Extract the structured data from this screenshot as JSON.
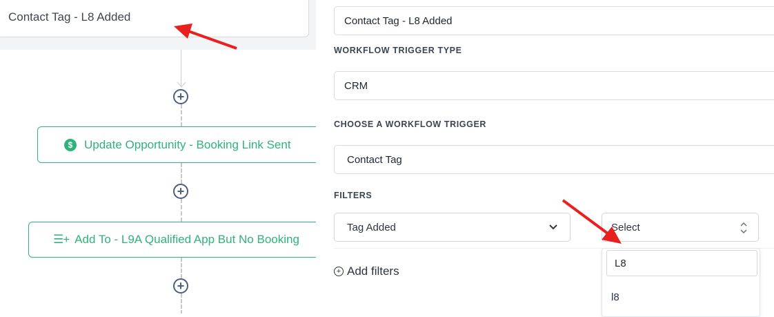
{
  "canvas": {
    "trigger_title": "Contact Tag - L8 Added",
    "actions": [
      {
        "label": "Update Opportunity - Booking Link Sent",
        "icon": "dollar-icon"
      },
      {
        "label": "Add To - L9A Qualified App But No Booking",
        "icon": "list-add-icon"
      }
    ],
    "add_node_symbol": "+"
  },
  "panel": {
    "trigger_name_value": "Contact Tag - L8 Added",
    "trigger_type_label": "WORKFLOW TRIGGER TYPE",
    "trigger_type_value": "CRM",
    "choose_trigger_label": "CHOOSE A WORKFLOW TRIGGER",
    "choose_trigger_value": "Contact Tag",
    "filters_label": "FILTERS",
    "filter_field_value": "Tag Added",
    "filter_value_placeholder": "Select",
    "dropdown": {
      "search_value": "L8",
      "options": [
        "l8"
      ]
    },
    "add_filters_label": "Add filters"
  },
  "colors": {
    "accent_green": "#2fb27b",
    "node_blue": "#4a5e82",
    "annotation_red": "#e8201e"
  }
}
